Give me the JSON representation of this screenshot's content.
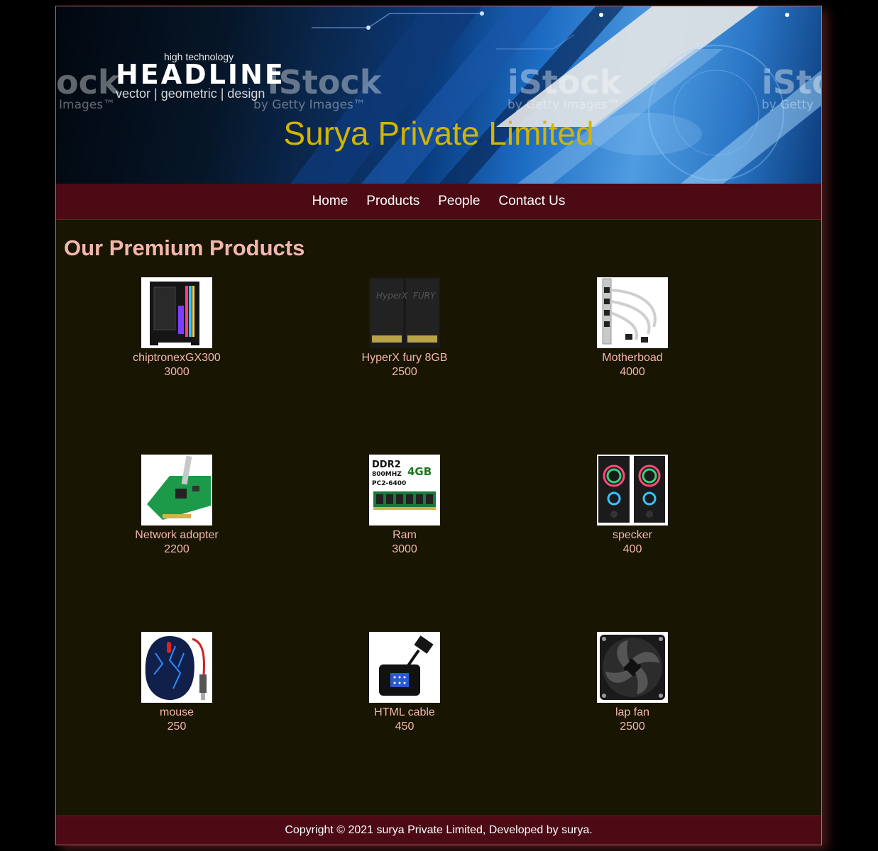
{
  "banner": {
    "company_name": "Surya Private Limited",
    "stock_headline_small": "high technology",
    "stock_headline_big": "HEADLINE",
    "stock_headline_sub": "vector | geometric | design",
    "watermarks": [
      {
        "big": "ock",
        "small": "Images™"
      },
      {
        "big": "iStock",
        "small": "by Getty Images™"
      },
      {
        "big": "iStock",
        "small": "by Getty Images™"
      },
      {
        "big": "iSto",
        "small": "by Getty"
      }
    ]
  },
  "nav": {
    "items": [
      "Home",
      "Products",
      "People",
      "Contact Us"
    ]
  },
  "main": {
    "title": "Our Premium Products",
    "products": [
      {
        "name": "chiptronexGX300",
        "price": "3000",
        "image": "pc-case-icon"
      },
      {
        "name": "HyperX fury 8GB",
        "price": "2500",
        "image": "ram-sticks-icon"
      },
      {
        "name": "Motherboad",
        "price": "4000",
        "image": "usb-bracket-icon"
      },
      {
        "name": "Network adopter",
        "price": "2200",
        "image": "network-card-icon"
      },
      {
        "name": "Ram",
        "price": "3000",
        "image": "ddr2-ram-icon",
        "image_text": [
          "DDR2",
          "800MHZ",
          "PC2-6400",
          "4GB"
        ]
      },
      {
        "name": "specker",
        "price": "400",
        "image": "speakers-icon"
      },
      {
        "name": "mouse",
        "price": "250",
        "image": "gaming-mouse-icon"
      },
      {
        "name": "HTML cable",
        "price": "450",
        "image": "hdmi-vga-adapter-icon"
      },
      {
        "name": "lap fan",
        "price": "2500",
        "image": "case-fan-icon"
      }
    ]
  },
  "footer": {
    "text": "Copyright © 2021 surya Private Limited, Developed by surya."
  },
  "colors": {
    "page_bg": "#000000",
    "content_bg": "#191503",
    "bar_bg": "#4b0a14",
    "accent_text": "#f2b7ab",
    "company_name": "#d4b400"
  }
}
